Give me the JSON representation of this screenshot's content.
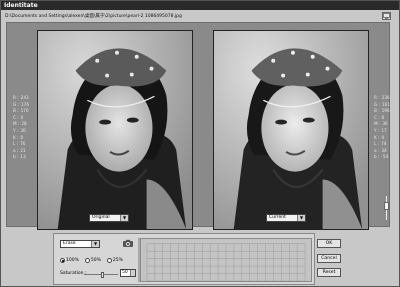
{
  "window": {
    "title": "Identitate"
  },
  "path": "D:\\Documents and Settings\\alexen\\桌面\\属于\\2\\picture\\pearl-2 1086495078.jpg",
  "stats_left": [
    {
      "label": "R :",
      "value": "243"
    },
    {
      "label": "G :",
      "value": "176"
    },
    {
      "label": "B :",
      "value": "170"
    },
    {
      "label": "C :",
      "value": "0"
    },
    {
      "label": "M :",
      "value": "28"
    },
    {
      "label": "Y :",
      "value": "30"
    },
    {
      "label": "K :",
      "value": "0"
    },
    {
      "label": "L :",
      "value": "76"
    },
    {
      "label": "a :",
      "value": "21"
    },
    {
      "label": "b :",
      "value": "13"
    }
  ],
  "stats_right": [
    {
      "label": "R :",
      "value": "236"
    },
    {
      "label": "G :",
      "value": "161"
    },
    {
      "label": "B :",
      "value": "196"
    },
    {
      "label": "C :",
      "value": "6"
    },
    {
      "label": "M :",
      "value": "36"
    },
    {
      "label": "Y :",
      "value": "17"
    },
    {
      "label": "K :",
      "value": "0"
    },
    {
      "label": "L :",
      "value": "74"
    },
    {
      "label": "a :",
      "value": "34"
    },
    {
      "label": "b :",
      "value": "-54"
    }
  ],
  "preview": {
    "left_select": "Original",
    "right_select": "Current"
  },
  "controls": {
    "mode_select": "Erase",
    "radio_options": [
      "100%",
      "50%",
      "25%"
    ],
    "radio_selected": 0,
    "saturation_label": "Saturation :",
    "saturation_value": "50",
    "saturation_level": 0.55
  },
  "buttons": {
    "ok": "OK",
    "cancel": "Cancel",
    "reset": "Reset"
  },
  "icons": {
    "tool": "screen-icon",
    "camera": "camera-icon"
  }
}
